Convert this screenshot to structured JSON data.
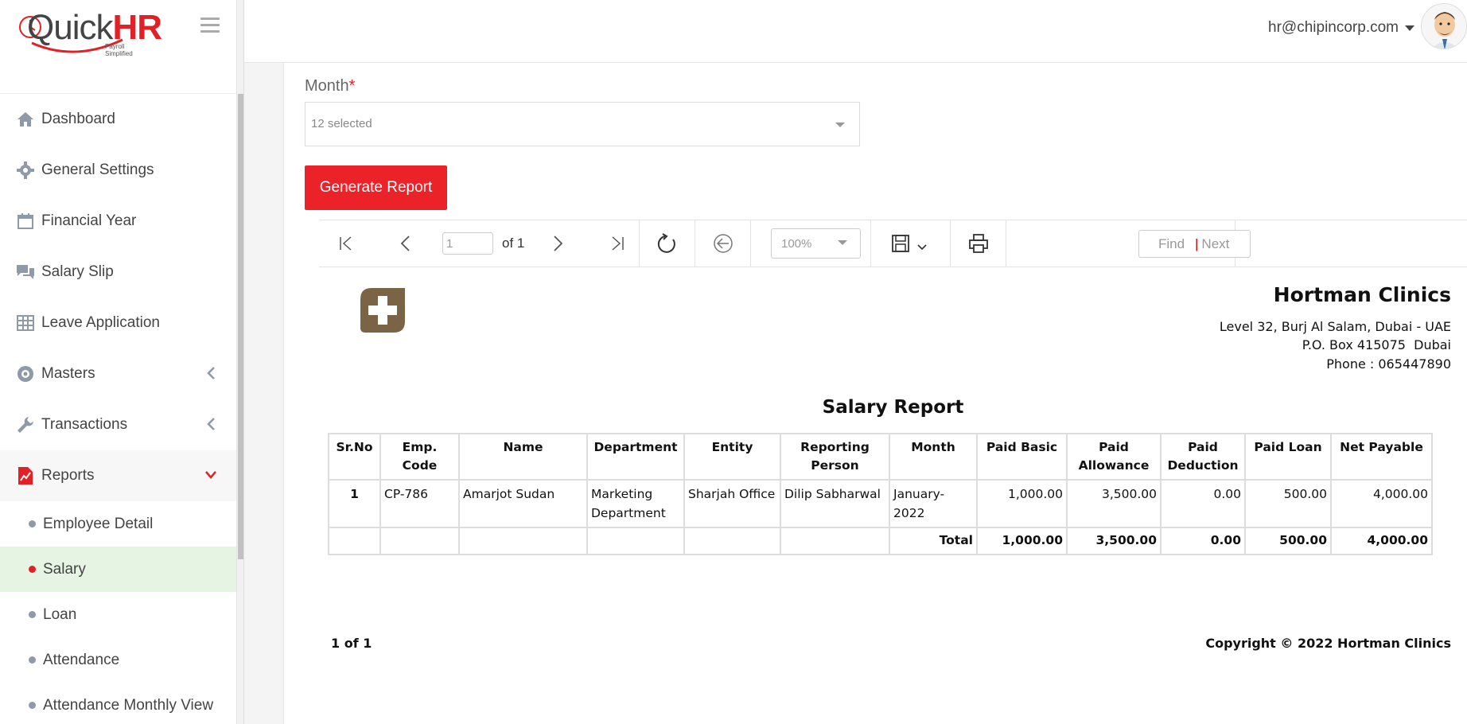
{
  "brand": {
    "name_part1": "Quick",
    "name_part2": "HR",
    "tagline": "Payroll Simplified"
  },
  "sidebar": {
    "items": [
      {
        "label": "Dashboard",
        "icon": "home-icon"
      },
      {
        "label": "General Settings",
        "icon": "gear-icon"
      },
      {
        "label": "Financial Year",
        "icon": "calendar-icon"
      },
      {
        "label": "Salary Slip",
        "icon": "chat-icon"
      },
      {
        "label": "Leave Application",
        "icon": "table-icon"
      },
      {
        "label": "Masters",
        "icon": "settings-circle-icon"
      },
      {
        "label": "Transactions",
        "icon": "wrench-icon"
      },
      {
        "label": "Reports",
        "icon": "report-chart-icon"
      }
    ],
    "sub_items": [
      {
        "label": "Employee Detail"
      },
      {
        "label": "Salary"
      },
      {
        "label": "Loan"
      },
      {
        "label": "Attendance"
      },
      {
        "label": "Attendance Monthly View"
      }
    ],
    "accent": "#e32026",
    "active_sub_bg": "#e6f4e4"
  },
  "header": {
    "user_email": "hr@chipincorp.com"
  },
  "form": {
    "month_label": "Month",
    "required_mark": "*",
    "month_value": "12 selected",
    "generate_label": "Generate Report",
    "button_color": "#ec2229"
  },
  "toolbar": {
    "page_value": "1",
    "page_of": "of 1",
    "zoom": "100%",
    "find_label": "Find",
    "next_sep": "|",
    "next_label": "Next"
  },
  "report": {
    "company": "Hortman Clinics",
    "address1": "Level 32, Burj Al Salam, Dubai - UAE",
    "address2": "P.O. Box 415075  Dubai",
    "address3": "Phone : 065447890",
    "title": "Salary Report",
    "columns": [
      "Sr.No",
      "Emp. Code",
      "Name",
      "Department",
      "Entity",
      "Reporting Person",
      "Month",
      "Paid Basic",
      "Paid Allowance",
      "Paid Deduction",
      "Paid Loan",
      "Net Payable"
    ],
    "rows": [
      {
        "sr": "1",
        "code": "CP-786",
        "name": "Amarjot Sudan",
        "department": "Marketing Department",
        "entity": "Sharjah Office",
        "reporting": "Dilip Sabharwal",
        "month": "January-2022",
        "basic": "1,000.00",
        "allowance": "3,500.00",
        "deduction": "0.00",
        "loan": "500.00",
        "net": "4,000.00"
      }
    ],
    "total": {
      "label": "Total",
      "basic": "1,000.00",
      "allowance": "3,500.00",
      "deduction": "0.00",
      "loan": "500.00",
      "net": "4,000.00"
    },
    "pager": "1 of 1",
    "copyright": "Copyright © 2022 Hortman Clinics"
  }
}
